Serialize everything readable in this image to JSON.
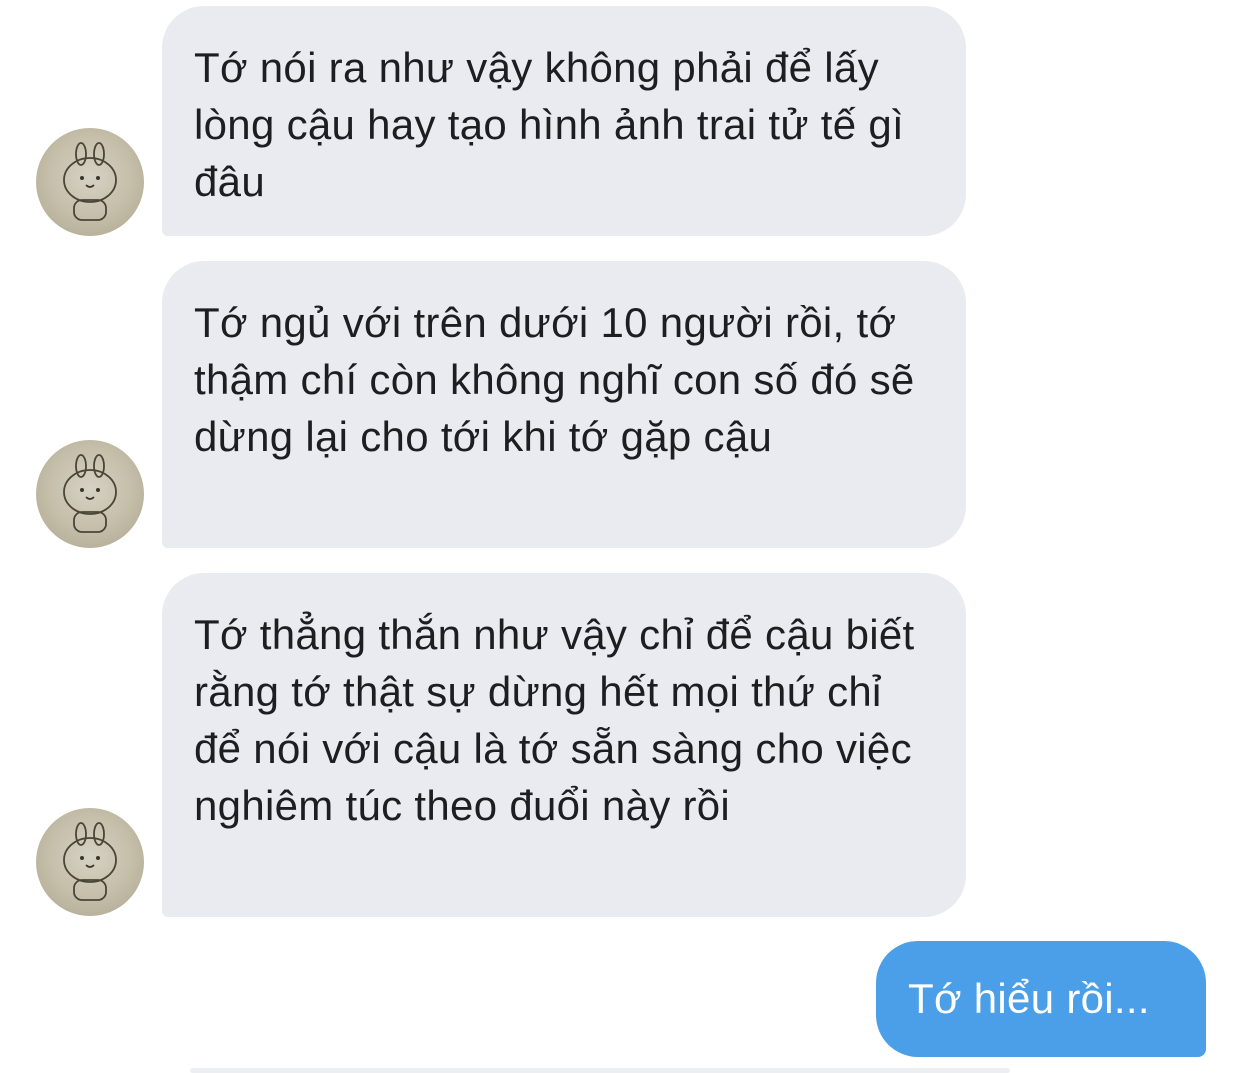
{
  "conversation": {
    "incoming": [
      {
        "text": "Tớ nói ra như vậy không phải để lấy lòng cậu hay tạo hình ảnh trai tử tế gì đâu"
      },
      {
        "text": "Tớ ngủ với trên dưới 10 người rồi, tớ thậm chí còn không nghĩ con số đó sẽ dừng lại cho tới khi tớ gặp cậu"
      },
      {
        "text": "Tớ thẳng thắn như vậy chỉ để cậu biết rằng tớ thật sự dừng hết mọi thứ chỉ để nói với cậu là tớ sẵn sàng cho việc nghiêm túc theo đuổi này rồi"
      }
    ],
    "outgoing": [
      {
        "text": "Tớ hiểu rồi..."
      }
    ]
  },
  "colors": {
    "incoming_bubble": "#e9ebf0",
    "outgoing_bubble": "#4a9fe8",
    "incoming_text": "#1d1e22",
    "outgoing_text": "#ffffff"
  },
  "icons": {
    "avatar": "bunny-sticker-avatar"
  }
}
